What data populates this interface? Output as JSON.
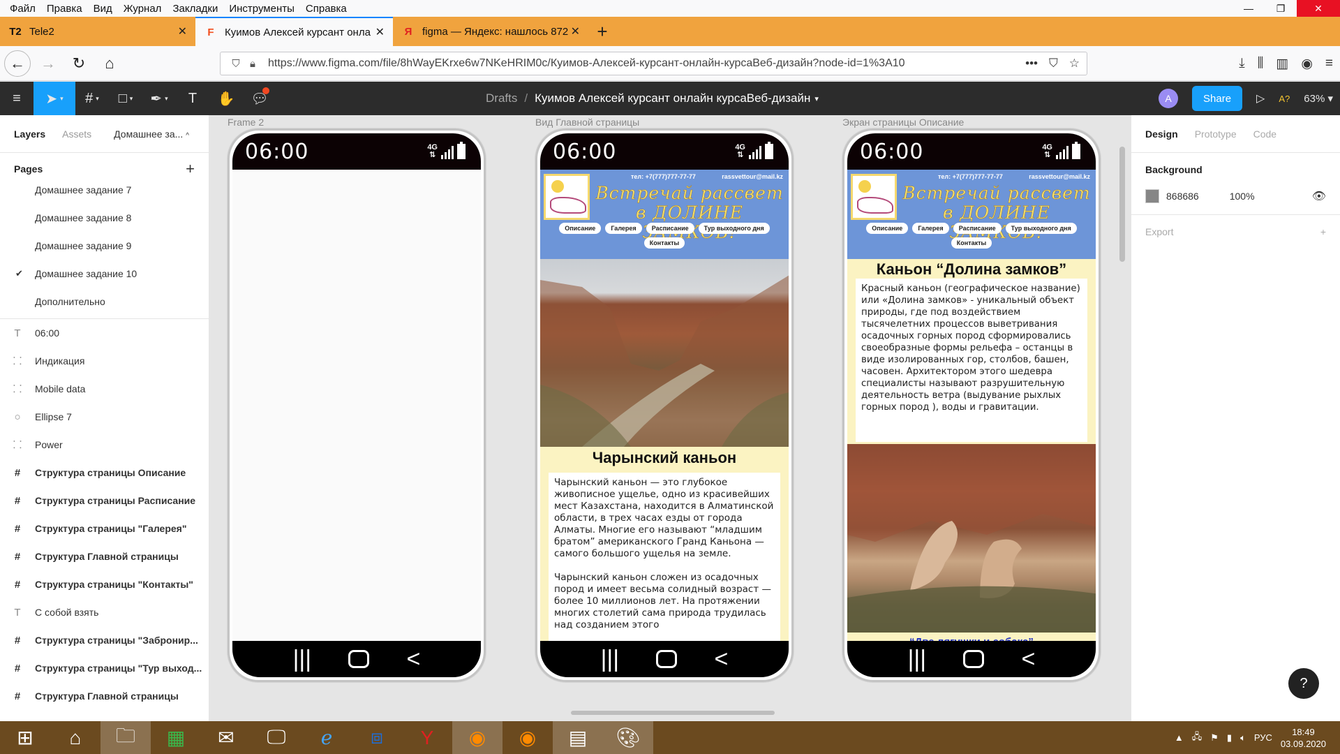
{
  "menubar": {
    "items": [
      "Файл",
      "Правка",
      "Вид",
      "Журнал",
      "Закладки",
      "Инструменты",
      "Справка"
    ]
  },
  "tabs": [
    {
      "icon": "T2",
      "title": "Tele2"
    },
    {
      "icon": "F",
      "title": "Куимов Алексей курсант онла"
    },
    {
      "icon": "Я",
      "title": "figma — Яндекс: нашлось 872"
    }
  ],
  "url": "https://www.figma.com/file/8hWayEKrxe6w7NKeHRIM0c/Куимов-Алексей-курсант-онлайн-курсаВеб-дизайн?node-id=1%3A10",
  "figma": {
    "breadcrumb_root": "Drafts",
    "file_name": "Куимов Алексей курсант онлайн курсаВеб-дизайн",
    "avatar": "A",
    "share": "Share",
    "a11y": "A?",
    "zoom": "63%"
  },
  "left_panel": {
    "tab_layers": "Layers",
    "tab_assets": "Assets",
    "current_page": "Домашнее за...",
    "pages_title": "Pages",
    "pages": [
      {
        "label": "Домашнее задание 7",
        "checked": false
      },
      {
        "label": "Домашнее задание 8",
        "checked": false
      },
      {
        "label": "Домашнее задание 9",
        "checked": false
      },
      {
        "label": "Домашнее задание 10",
        "checked": true
      },
      {
        "label": "Дополнительно",
        "checked": false
      }
    ],
    "layers": [
      {
        "icon": "T",
        "label": "06:00",
        "frame": false
      },
      {
        "icon": "⸬",
        "label": "Индикация",
        "frame": false
      },
      {
        "icon": "⸬",
        "label": "Mobile data",
        "frame": false
      },
      {
        "icon": "○",
        "label": "Ellipse 7",
        "frame": false
      },
      {
        "icon": "⸬",
        "label": "Power",
        "frame": false
      },
      {
        "icon": "#",
        "label": "Структура страницы Описание",
        "frame": true
      },
      {
        "icon": "#",
        "label": "Структура страницы Расписание",
        "frame": true
      },
      {
        "icon": "#",
        "label": "Структура страницы \"Галерея\"",
        "frame": true
      },
      {
        "icon": "#",
        "label": "Структура Главной страницы",
        "frame": true
      },
      {
        "icon": "#",
        "label": "Структура страницы \"Контакты\"",
        "frame": true
      },
      {
        "icon": "T",
        "label": "С собой взять",
        "frame": false
      },
      {
        "icon": "#",
        "label": "Структура страницы \"Забронир...",
        "frame": true
      },
      {
        "icon": "#",
        "label": "Структура страницы \"Тур выход...",
        "frame": true
      },
      {
        "icon": "#",
        "label": "Структура Главной страницы",
        "frame": true
      }
    ]
  },
  "frames": {
    "f1_label": "Frame 2",
    "f2_label": "Вид Главной страницы",
    "f3_label": "Экран страницы Описание",
    "time": "06:00",
    "net": "4G",
    "phone": "тел: +7(777)777-77-77",
    "email": "rassvettour@mail.kz",
    "slogan": "Встречай рассвет в ДОЛИНЕ ЗАМКОВ!",
    "menu": [
      "Описание",
      "Галерея",
      "Расписание",
      "Тур выходного дня",
      "Контакты"
    ],
    "main_title": "Чарынский каньон",
    "main_p1": "Чарынский каньон — это глубокое живописное ущелье, одно из красивейших мест Казахстана, находится в Алматинской области, в трех часах езды от города Алматы. Многие его называют “младшим братом” американского Гранд Каньона — самого большого ущелья на земле.",
    "main_p2": "Чарынский каньон сложен из осадочных пород и имеет весьма солидный возраст — более 10 миллионов лет. На протяжении многих столетий сама природа трудилась над созданием этого",
    "desc_title": "Каньон “Долина замков”",
    "desc_text": "Красный каньон (географическое название) или «Долина замков»  - уникальный объект природы, где под воздействием тысячелетних процессов выветривания осадочных горных пород сформировались своеобразные формы рельефа – останцы в виде изолированных гор, столбов, башен, часовен.  Архитектором этого шедевра специалисты называют разрушительную деятельность ветра (выдувание рыхлых горных пород ), воды и гравитации.",
    "caption": "“Две лягушки и собака”"
  },
  "right_panel": {
    "tab_design": "Design",
    "tab_prototype": "Prototype",
    "tab_code": "Code",
    "background_title": "Background",
    "bg_hex": "868686",
    "bg_opacity": "100%",
    "export_title": "Export",
    "help": "?"
  },
  "taskbar": {
    "lang": "РУС",
    "time": "18:49",
    "date": "03.09.2020"
  },
  "colors": {
    "figma_blue": "#18a0fb",
    "tab_bar": "#f0a33e",
    "site_header": "#6d95d8",
    "site_band": "#fbf3c2",
    "caption": "#1e2fbf"
  }
}
